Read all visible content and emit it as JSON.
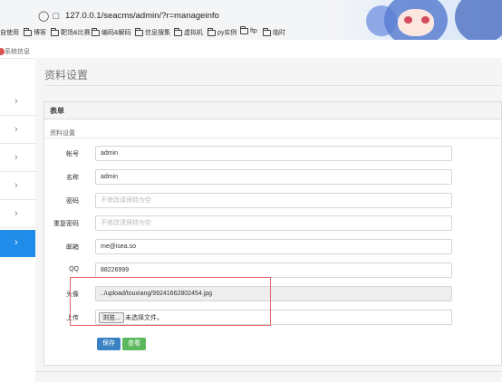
{
  "browser": {
    "url": "127.0.0.1/seacms/admin/?r=manageinfo",
    "bookmarks": [
      "自使用",
      "博客",
      "靶场&比赛",
      "编码&解码",
      "信息搜集",
      "虚拟机",
      "py实例",
      "ftp",
      "临时"
    ]
  },
  "app": {
    "title": "系统信息"
  },
  "page": {
    "title": "资料设置",
    "panel_title": "表单",
    "subheading": "资料设置"
  },
  "form": {
    "account_label": "帐号",
    "account_value": "admin",
    "name_label": "名称",
    "name_value": "admin",
    "password_label": "密码",
    "password_placeholder": "不修改请保持为空",
    "repeat_label": "重复密码",
    "repeat_placeholder": "不修改请保持为空",
    "email_label": "邮箱",
    "email_value": "me@isea.so",
    "qq_label": "QQ",
    "qq_value": "88226999",
    "avatar_label": "头像",
    "avatar_value": "../upload/touxiang/99241662802454.jpg",
    "upload_label": "上传",
    "browse_button": "浏览...",
    "no_file_text": "未选择文件。",
    "save_button": "保存",
    "view_button": "查看"
  },
  "colors": {
    "active_sidebar": "#1e8ce8",
    "save_button": "#3a82c4",
    "view_button": "#5cb85c",
    "highlight_box": "#e46a6a"
  }
}
